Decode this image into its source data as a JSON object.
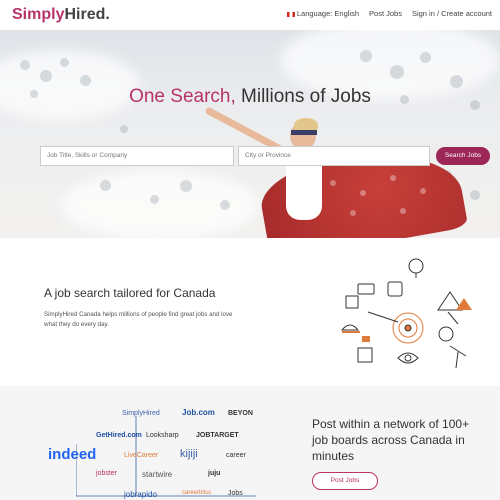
{
  "header": {
    "logo_part1": "Simply",
    "logo_part2": "Hired.",
    "language": "Language: English",
    "post_jobs": "Post Jobs",
    "sign_in": "Sign in / Create account"
  },
  "hero": {
    "title_accent": "One Search,",
    "title_rest": " Millions of Jobs",
    "job_placeholder": "Job Title, Skills or Company",
    "location_placeholder": "City or Province",
    "search_button": "Search Jobs"
  },
  "tailored": {
    "heading": "A job search tailored for Canada",
    "body": "SimplyHired Canada helps millions of people find great jobs and love what they do every day."
  },
  "network": {
    "heading": "Post within a network of 100+ job boards across Canada in minutes",
    "button": "Post Jobs",
    "logos": [
      "SimplyHired",
      "Job.com",
      "BEYON",
      "GetHired.com",
      "Looksharp",
      "JOBTARGET",
      "indeed",
      "LiveCareer",
      "kijiji",
      "career",
      "jobster",
      "startwire",
      "juju",
      "jobrapido",
      "careerbliss",
      "Jobs"
    ]
  },
  "colors": {
    "accent": "#b8336a",
    "button": "#9c2756"
  }
}
